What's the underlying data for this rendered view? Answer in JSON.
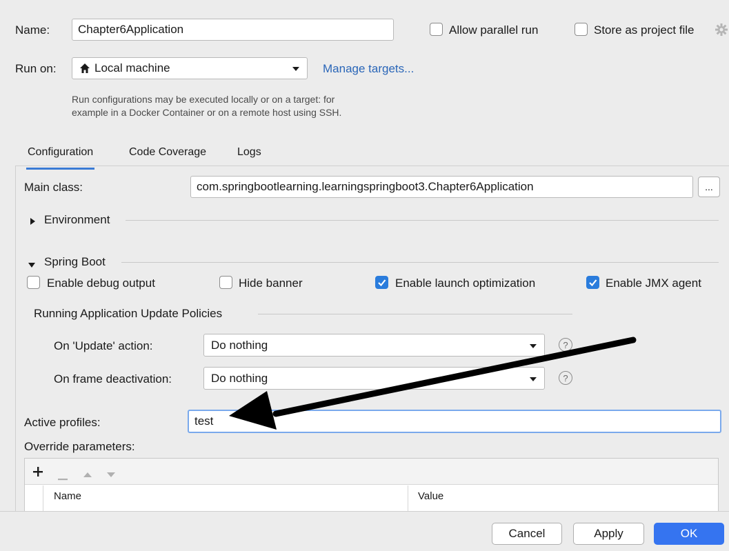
{
  "header": {
    "name_label": "Name:",
    "name_value": "Chapter6Application",
    "allow_parallel_label": "Allow parallel run",
    "store_as_project_label": "Store as project file",
    "run_on_label": "Run on:",
    "run_on_value": "Local machine",
    "manage_targets_label": "Manage targets...",
    "help_text_line1": "Run configurations may be executed locally or on a target: for",
    "help_text_line2": "example in a Docker Container or on a remote host using SSH."
  },
  "tabs": [
    {
      "label": "Configuration",
      "active": true
    },
    {
      "label": "Code Coverage",
      "active": false
    },
    {
      "label": "Logs",
      "active": false
    }
  ],
  "config": {
    "main_class_label": "Main class:",
    "main_class_value": "com.springbootlearning.learningspringboot3.Chapter6Application",
    "browse_label": "...",
    "environment_label": "Environment",
    "spring_boot_label": "Spring Boot",
    "enable_debug_label": "Enable debug output",
    "hide_banner_label": "Hide banner",
    "enable_launch_opt_label": "Enable launch optimization",
    "enable_jmx_label": "Enable JMX agent",
    "update_policies_label": "Running Application Update Policies",
    "on_update_label": "On 'Update' action:",
    "on_update_value": "Do nothing",
    "on_frame_label": "On frame deactivation:",
    "on_frame_value": "Do nothing",
    "help_glyph": "?",
    "active_profiles_label": "Active profiles:",
    "active_profiles_value": "test",
    "override_params_label": "Override parameters:",
    "table_headers": [
      "Name",
      "Value"
    ]
  },
  "checkboxes": {
    "allow_parallel": false,
    "store_as_project": false,
    "enable_debug": false,
    "hide_banner": false,
    "enable_launch_opt": true,
    "enable_jmx": true
  },
  "toolbar_icons": [
    "plus-icon",
    "minus-icon",
    "move-up-icon",
    "move-down-icon"
  ],
  "footer": {
    "cancel_label": "Cancel",
    "apply_label": "Apply",
    "ok_label": "OK"
  },
  "colors": {
    "accent": "#3574f0",
    "checkbox_checked": "#2a7cdc",
    "link": "#2a66b8",
    "annotation_arrow": "#000000"
  }
}
